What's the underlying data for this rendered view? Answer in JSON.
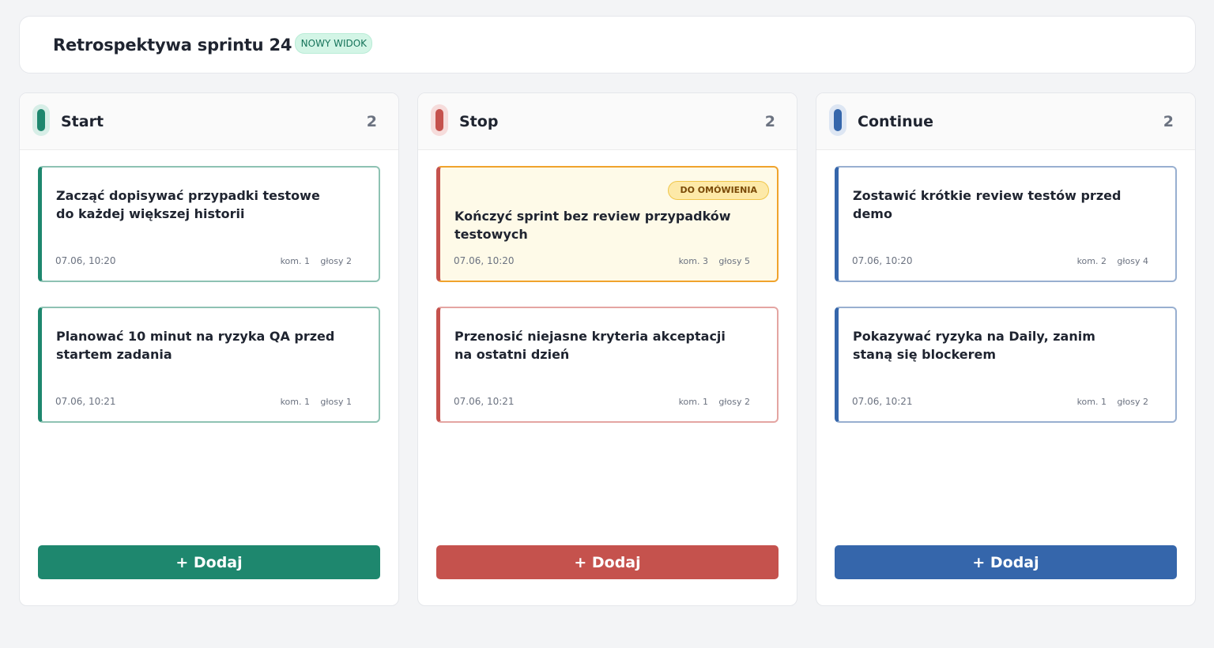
{
  "header": {
    "title": "Retrospektywa sprintu 24",
    "badge": "NOWY WIDOK"
  },
  "colors": {
    "start": "#1e876e",
    "stop": "#c5524d",
    "continue": "#3566ab",
    "highlight_border": "#f0a32c",
    "highlight_bg": "#fefae8"
  },
  "columns": [
    {
      "key": "start",
      "title": "Start",
      "count": "2",
      "add_label": "+ Dodaj",
      "cards": [
        {
          "text": "Zacząć dopisywać przypadki testowe do każdej większej historii",
          "time": "07.06, 10:20",
          "comments": "kom. 1",
          "votes": "głosy 2",
          "badge": ""
        },
        {
          "text": "Planować 10 minut na ryzyka QA przed startem zadania",
          "time": "07.06, 10:21",
          "comments": "kom. 1",
          "votes": "głosy 1",
          "badge": ""
        }
      ]
    },
    {
      "key": "stop",
      "title": "Stop",
      "count": "2",
      "add_label": "+ Dodaj",
      "cards": [
        {
          "text": "Kończyć sprint bez review przypadków testowych",
          "time": "07.06, 10:20",
          "comments": "kom. 3",
          "votes": "głosy 5",
          "badge": "DO OMÓWIENIA"
        },
        {
          "text": "Przenosić niejasne kryteria akceptacji na ostatni dzień",
          "time": "07.06, 10:21",
          "comments": "kom. 1",
          "votes": "głosy 2",
          "badge": ""
        }
      ]
    },
    {
      "key": "continue",
      "title": "Continue",
      "count": "2",
      "add_label": "+ Dodaj",
      "cards": [
        {
          "text": "Zostawić krótkie review testów przed demo",
          "time": "07.06, 10:20",
          "comments": "kom. 2",
          "votes": "głosy 4",
          "badge": ""
        },
        {
          "text": "Pokazywać ryzyka na Daily, zanim staną się blockerem",
          "time": "07.06, 10:21",
          "comments": "kom. 1",
          "votes": "głosy 2",
          "badge": ""
        }
      ]
    }
  ]
}
